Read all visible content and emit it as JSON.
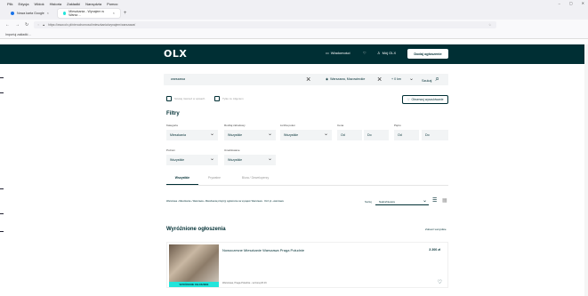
{
  "browser": {
    "menu": [
      "Plik",
      "Edycja",
      "Widok",
      "Historia",
      "Zakładki",
      "Narzędzia",
      "Pomoc"
    ],
    "tabs": [
      {
        "label": "Nowa karta Google"
      },
      {
        "label": "Mieszkania - Wynajem w Warsz…"
      }
    ],
    "new_tab_icon": "+",
    "url": "https://www.olx.pl/nieruchomosci/mieszkania/wynajem/warszawa/",
    "bookmark": "Importuj zakładki…",
    "window_controls": [
      "–",
      "▢",
      "✕"
    ]
  },
  "header": {
    "logo": "OLX",
    "messages_label": "Wiadomości",
    "account_label": "Mój OLX",
    "add_button_label": "Dodaj ogłoszenie"
  },
  "search": {
    "query": "warszawa",
    "location": "Warszawa, Mazowieckie",
    "radius": "+ 0 km",
    "search_button_label": "Szukaj"
  },
  "checkboxes": [
    {
      "label": "Szukaj również w opisach"
    },
    {
      "label": "Tylko ze zdjęciem"
    }
  ],
  "watch_button_label": "Obserwuj wyszukiwanie",
  "filters": {
    "title": "Filtry",
    "row1": [
      {
        "label": "Kategoria",
        "value": "Mieszkania"
      },
      {
        "label": "Rodzaj zabudowy",
        "value": "Wszystkie"
      },
      {
        "label": "Liczba pokoi",
        "value": "Wszystkie"
      },
      {
        "label": "Cena",
        "from": "Od",
        "to": "Do"
      },
      {
        "label": "Piętro",
        "from": "Od",
        "to": "Do"
      }
    ],
    "row2": [
      {
        "label": "Poziom",
        "value": "Wszystkie"
      },
      {
        "label": "Umeblowane",
        "value": "Wszystkie"
      }
    ]
  },
  "result_tabs": [
    "Wszystkie",
    "Prywatne",
    "Biura / Deweloperzy"
  ],
  "breadcrumb": "Warszawa › Mieszkania › Warszawa › Mieszkania przejrzyj ogłoszenia na wynajem Warszawa · OLX.pl › warszawa",
  "sort": {
    "label": "Sortuj",
    "value": "Najtrafniejsze"
  },
  "featured": {
    "title": "Wyróżnione ogłoszenia",
    "see_all": "Zobacz wszystkie"
  },
  "listing": {
    "title": "Nowoczesne Mieszkanie Warszawa Praga Południe",
    "price": "3 200 zł",
    "location": "Warszawa, Praga-Południe - wczoraj 20:16",
    "badge": "WYRÓŻNIONE OGŁOSZENIE"
  },
  "colors": {
    "brand_dark": "#002f34",
    "brand_accent": "#23e5db"
  }
}
